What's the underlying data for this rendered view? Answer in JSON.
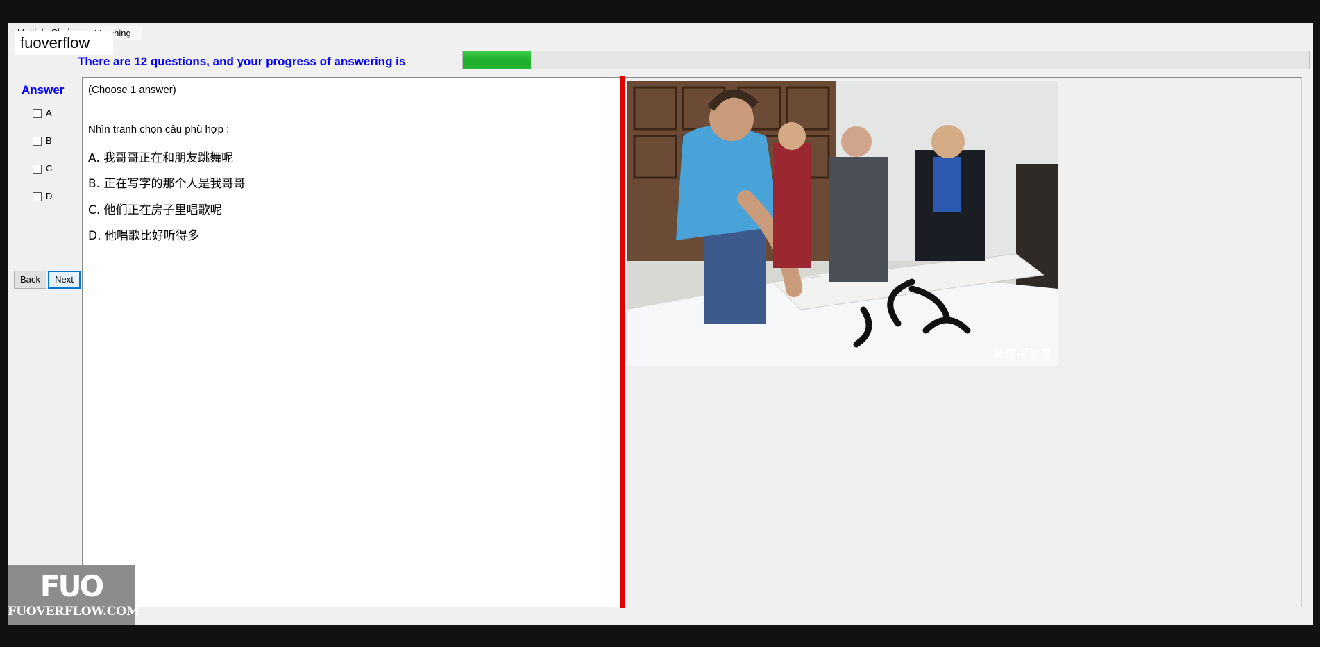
{
  "tabs": [
    "Multiple Choice",
    "Matching"
  ],
  "overlay_label": "fuoverflow",
  "progress": {
    "text": "There are 12 questions, and your progress of answering is",
    "fraction": 0.08
  },
  "answer": {
    "title": "Answer",
    "options": [
      "A",
      "B",
      "C",
      "D"
    ]
  },
  "buttons": {
    "back": "Back",
    "next": "Next"
  },
  "question": {
    "instruction": "(Choose 1 answer)",
    "prompt": "Nhìn tranh chọn câu phù hợp :",
    "options": [
      "A.  我哥哥正在和朋友跳舞呢",
      "B.  正在写字的那个人是我哥哥",
      "C.  他们正在房子里唱歌呢",
      "D.  他唱歌比好听得多"
    ]
  },
  "image": {
    "watermark": "教育探索者"
  },
  "logo": {
    "mark": "FUO",
    "domain": "FUOVERFLOW.COM"
  },
  "colors": {
    "accent_blue": "#0000ff",
    "divider_red": "#e00000",
    "progress_green": "#1eaf2b"
  }
}
